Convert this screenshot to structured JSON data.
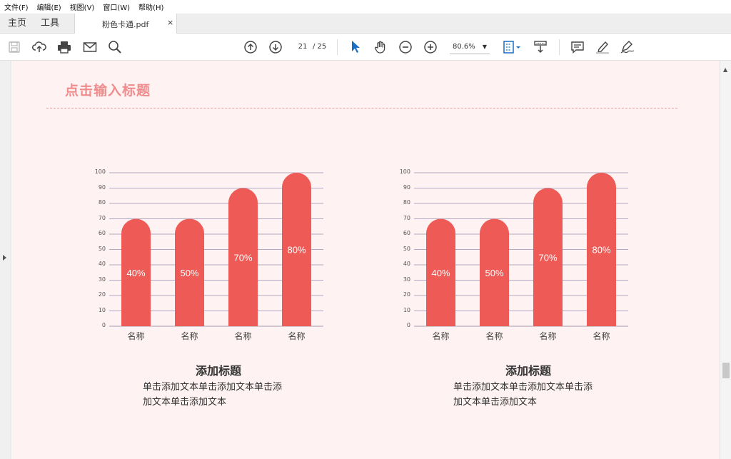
{
  "menu": [
    "文件(F)",
    "编辑(E)",
    "视图(V)",
    "窗口(W)",
    "帮助(H)"
  ],
  "tabs": {
    "home": "主页",
    "tools": "工具",
    "document": "粉色卡通.pdf",
    "close": "×"
  },
  "toolbar": {
    "icons": [
      "save-icon",
      "upload-cloud-icon",
      "print-icon",
      "mail-icon",
      "search-zoom-icon",
      "page-up-icon",
      "page-down-icon",
      "select-cursor-icon",
      "hand-icon",
      "zoom-out-icon",
      "zoom-in-icon",
      "fit-page-icon",
      "scroll-mode-icon",
      "comment-icon",
      "highlight-icon",
      "sign-icon"
    ],
    "page_current": "21",
    "page_total": "/ 25",
    "zoom": "80.6%",
    "accent": "#1a6fc4"
  },
  "page": {
    "background": "#fff2f2",
    "title": "点击输入标题",
    "title_color": "#f08c8c"
  },
  "charts": [
    {
      "caption_title": "添加标题",
      "caption_line1": "单击添加文本单击添加文本单击添",
      "caption_line2": "加文本单击添加文本"
    },
    {
      "caption_title": "添加标题",
      "caption_line1": "单击添加文本单击添加文本单击添",
      "caption_line2": "加文本单击添加文本"
    }
  ],
  "chart_data": [
    {
      "type": "bar",
      "categories": [
        "名称",
        "名称",
        "名称",
        "名称"
      ],
      "values": [
        70,
        70,
        90,
        100
      ],
      "data_labels": [
        "40%",
        "50%",
        "70%",
        "80%"
      ],
      "ylim": [
        0,
        100
      ],
      "yticks": [
        "0",
        "10",
        "20",
        "30",
        "40",
        "50",
        "60",
        "70",
        "80",
        "90",
        "100"
      ],
      "grid": true,
      "bar_color": "#ee5b57"
    },
    {
      "type": "bar",
      "categories": [
        "名称",
        "名称",
        "名称",
        "名称"
      ],
      "values": [
        70,
        70,
        90,
        100
      ],
      "data_labels": [
        "40%",
        "50%",
        "70%",
        "80%"
      ],
      "ylim": [
        0,
        100
      ],
      "yticks": [
        "0",
        "10",
        "20",
        "30",
        "40",
        "50",
        "60",
        "70",
        "80",
        "90",
        "100"
      ],
      "grid": true,
      "bar_color": "#ee5b57"
    }
  ]
}
